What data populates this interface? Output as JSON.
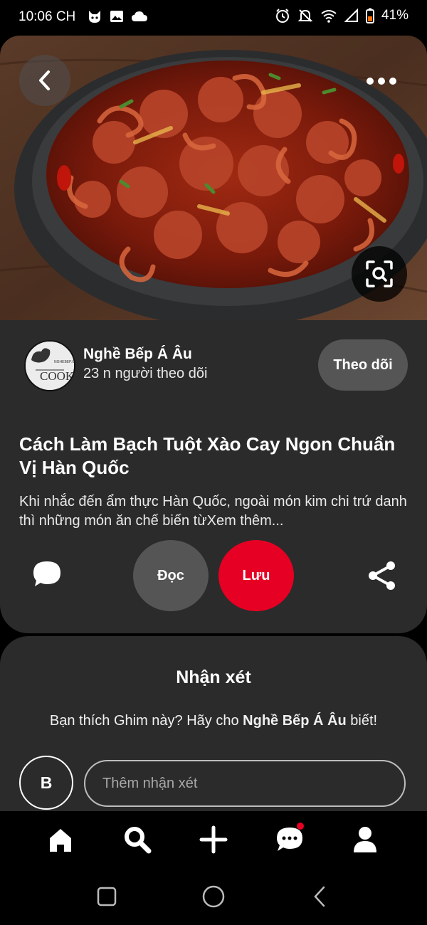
{
  "status_bar": {
    "time": "10:06 CH",
    "battery": "41%"
  },
  "creator": {
    "name": "Nghề Bếp Á Âu",
    "followers": "23 n người theo dõi",
    "follow_label": "Theo dõi",
    "avatar_text": "COOK"
  },
  "pin": {
    "title": "Cách Làm Bạch Tuột Xào Cay Ngon Chuẩn Vị Hàn Quốc",
    "description": "Khi nhắc đến ẩm thực Hàn Quốc, ngoài món kim chi trứ danh thì những món ăn chế biến từ",
    "see_more": "Xem thêm...",
    "read_label": "Đọc",
    "save_label": "Lưu"
  },
  "comments": {
    "title": "Nhận xét",
    "prompt_before": "Bạn thích Ghim này? Hãy cho ",
    "prompt_name": "Nghề Bếp Á Âu",
    "prompt_after": " biết!",
    "user_initial": "B",
    "input_placeholder": "Thêm nhận xét"
  },
  "colors": {
    "save_button": "#e60023",
    "card_bg": "#2b2b2b",
    "secondary_button": "#555555"
  },
  "icons": {
    "back": "chevron-left-icon",
    "more": "more-dots-icon",
    "lens": "visual-search-icon",
    "comment": "speech-bubble-icon",
    "share": "share-icon",
    "nav": [
      "home-icon",
      "search-icon",
      "plus-icon",
      "messages-icon",
      "profile-icon"
    ]
  }
}
